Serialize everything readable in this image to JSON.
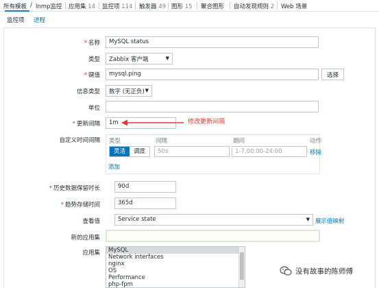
{
  "topnav": {
    "all_templates": "所有模板",
    "template_name": "lnmp监控",
    "applications": "应用集",
    "applications_count": "14",
    "items": "监控项",
    "items_count": "114",
    "triggers": "触发器",
    "triggers_count": "49",
    "graphs": "图形",
    "graphs_count": "15",
    "screens": "聚合图形",
    "discovery": "自动发现规则",
    "discovery_count": "2",
    "web": "Web 场景"
  },
  "subtabs": {
    "item": "监控项",
    "process": "进程"
  },
  "form": {
    "name_label": "名称",
    "name_value": "MySQL status",
    "type_label": "类型",
    "type_value": "Zabbix 客户端",
    "key_label": "键值",
    "key_value": "mysql.ping",
    "select_button": "选择",
    "info_type_label": "信息类型",
    "info_type_value": "数字 (无正负)",
    "units_label": "单位",
    "units_value": "",
    "interval_label": "更新间隔",
    "interval_value": "1m",
    "annotation": "修改更新间隔",
    "custom_label": "自定义时间间隔",
    "custom": {
      "col_type": "类型",
      "col_interval": "间隔",
      "col_period": "期间",
      "col_action": "动作",
      "flexible": "灵活",
      "scheduling": "调度",
      "interval_placeholder": "50s",
      "period_placeholder": "1-7,00:00-24:00",
      "remove": "移除",
      "add": "添加"
    },
    "history_label": "历史数据保留时长",
    "history_value": "90d",
    "trends_label": "趋势存储时间",
    "trends_value": "365d",
    "valuemap_label": "查看值",
    "valuemap_value": "Service state",
    "valuemap_link": "展示值映射",
    "new_app_label": "新的应用集",
    "new_app_value": "",
    "apps_label": "应用集",
    "apps": [
      "MySQL",
      "Network interfaces",
      "nginx",
      "OS",
      "Performance",
      "php-fpm"
    ]
  },
  "watermark": "没有故事的陈师傅",
  "colors": {
    "link": "#0275b8",
    "required": "#e33734",
    "annotation": "#e33734"
  }
}
